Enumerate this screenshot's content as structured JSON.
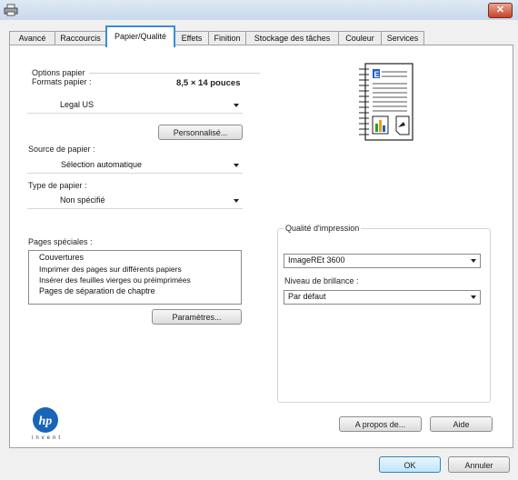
{
  "window": {
    "close_label": "✕"
  },
  "tabs": [
    "Avancé",
    "Raccourcis",
    "Papier/Qualité",
    "Effets",
    "Finition",
    "Stockage des tâches",
    "Couleur",
    "Services"
  ],
  "paper": {
    "group_title": "Options papier",
    "formats_label": "Formats papier :",
    "size_readout": "8,5 × 14 pouces",
    "format_value": "Legal US",
    "custom_button": "Personnalisé...",
    "source_label": "Source de papier :",
    "source_value": "Sélection automatique",
    "type_label": "Type de papier :",
    "type_value": "Non spécifié"
  },
  "special": {
    "label": "Pages spéciales :",
    "items": [
      "Couvertures",
      "Imprimer des pages sur différents papiers",
      "Insérer des feuilles vierges ou préimprimées",
      "Pages de séparation de chaptre"
    ],
    "settings_button": "Paramètres..."
  },
  "quality": {
    "group_title": "Qualité d'impression",
    "value": "ImageREt 3600",
    "gloss_label": "Niveau de brillance :",
    "gloss_value": "Par défaut"
  },
  "logo": {
    "tagline": "invent",
    "mark": "hp"
  },
  "buttons": {
    "about": "A propos de...",
    "help": "Aide",
    "ok": "OK",
    "cancel": "Annuler"
  }
}
